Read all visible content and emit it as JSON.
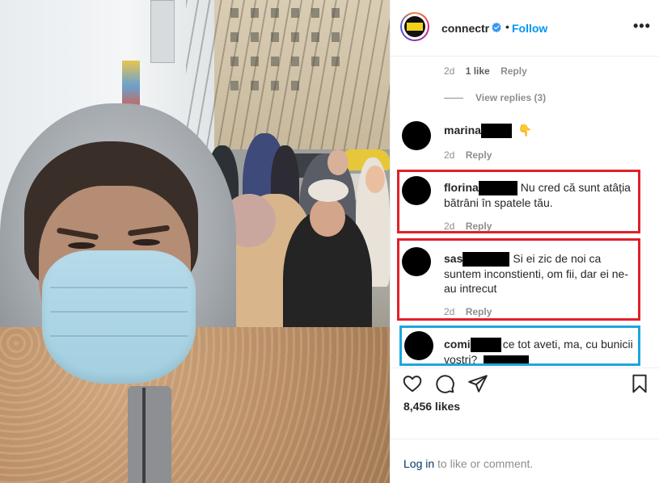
{
  "colors": {
    "follow_blue": "#0095f6",
    "highlight_red": "#e0212a",
    "highlight_blue": "#1ca6de",
    "meta_gray": "#8e8e8e",
    "text_dark": "#262626"
  },
  "post": {
    "username": "connectr",
    "verified_icon": "verified-badge-icon",
    "separator": "•",
    "follow_label": "Follow",
    "more_icon": "more-options-icon",
    "more_glyph": "•••"
  },
  "comments": {
    "top_meta": {
      "age": "2d",
      "likes": "1 like",
      "reply": "Reply"
    },
    "view_replies": "View replies (3)",
    "items": [
      {
        "user": "marina",
        "text": "",
        "emoji": "👇",
        "age": "2d",
        "reply": "Reply"
      },
      {
        "user": "florina",
        "text": "Nu cred că sunt atâția bătrâni în spatele tău.",
        "age": "2d",
        "reply": "Reply"
      },
      {
        "user": "sas",
        "text": "Si ei zic de noi ca suntem inconstienti, om fii, dar ei ne-au intrecut",
        "age": "2d",
        "reply": "Reply"
      },
      {
        "user": "comi",
        "text": "ce tot aveti, ma, cu bunicii vostri?",
        "age": "",
        "reply": ""
      }
    ]
  },
  "actions": {
    "like_icon": "heart-icon",
    "comment_icon": "comment-icon",
    "share_icon": "share-icon",
    "save_icon": "bookmark-icon"
  },
  "likes_count": "8,456 likes",
  "footer": {
    "login_link": "Log in",
    "login_suffix": " to like or comment."
  }
}
